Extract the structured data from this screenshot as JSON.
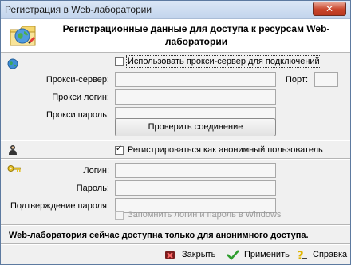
{
  "window": {
    "title": "Регистрация в Web-лаборатории",
    "close_glyph": "✕"
  },
  "header": {
    "title": "Регистрационные данные для доступа к ресурсам Web-лаборатории",
    "icon": "folder-globe-icon"
  },
  "proxy": {
    "icon": "globe-icon",
    "use_proxy_label": "Использовать прокси-сервер для подключений",
    "use_proxy_checked": false,
    "server_label": "Прокси-сервер:",
    "server_value": "",
    "port_label": "Порт:",
    "port_value": "",
    "login_label": "Прокси логин:",
    "login_value": "",
    "password_label": "Прокси пароль:",
    "password_value": "",
    "check_button": "Проверить соединение"
  },
  "anonymous": {
    "icon": "user-icon",
    "label": "Регистрироваться как анонимный пользователь",
    "checked": true
  },
  "credentials": {
    "icon": "key-icon",
    "login_label": "Логин:",
    "password_label": "Пароль:",
    "confirm_label": "Подтверждение пароля:",
    "remember_label": "Запомнить логин и пароль в Windows",
    "remember_checked": false
  },
  "status": {
    "text": "Web-лаборатория сейчас доступна только для анонимного доступа."
  },
  "toolbar": {
    "close_label": "Закрыть",
    "apply_label": "Применить",
    "help_label": "Справка"
  },
  "colors": {
    "window_bg": "#f0f0f0",
    "title_gradient_top": "#dbe7f6",
    "close_red": "#c9452b"
  }
}
